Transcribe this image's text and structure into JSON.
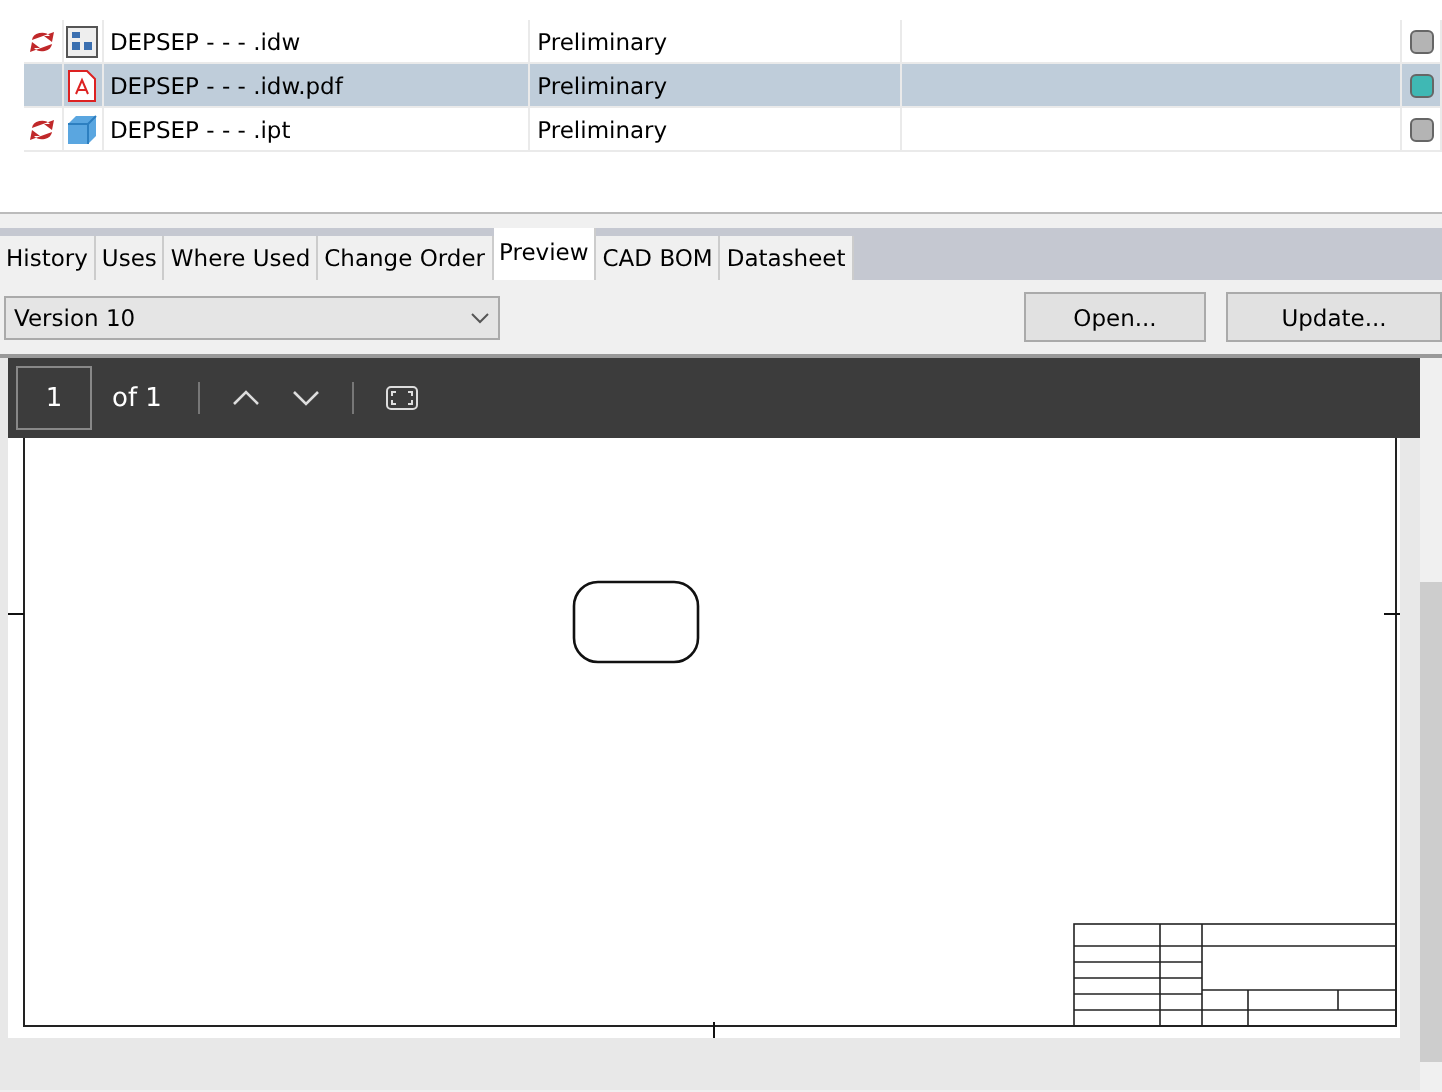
{
  "files": [
    {
      "sync": true,
      "kind": "drawing",
      "name": "DEPSEP - - - .idw",
      "state": "Preliminary",
      "selected": false,
      "color": "#b4b4b4"
    },
    {
      "sync": false,
      "kind": "pdf",
      "name": "DEPSEP - - - .idw.pdf",
      "state": "Preliminary",
      "selected": true,
      "color": "#3fb8b4"
    },
    {
      "sync": true,
      "kind": "part",
      "name": "DEPSEP - - - .ipt",
      "state": "Preliminary",
      "selected": false,
      "color": "#b4b4b4"
    }
  ],
  "tabs": [
    {
      "label": "History",
      "selected": false
    },
    {
      "label": "Uses",
      "selected": false
    },
    {
      "label": "Where Used",
      "selected": false
    },
    {
      "label": "Change Order",
      "selected": false
    },
    {
      "label": "Preview",
      "selected": true
    },
    {
      "label": "CAD BOM",
      "selected": false
    },
    {
      "label": "Datasheet",
      "selected": false
    }
  ],
  "version": {
    "value": "Version 10"
  },
  "buttons": [
    "Open...",
    "Update..."
  ],
  "viewer": {
    "page": "1",
    "page_count": "of 1"
  }
}
